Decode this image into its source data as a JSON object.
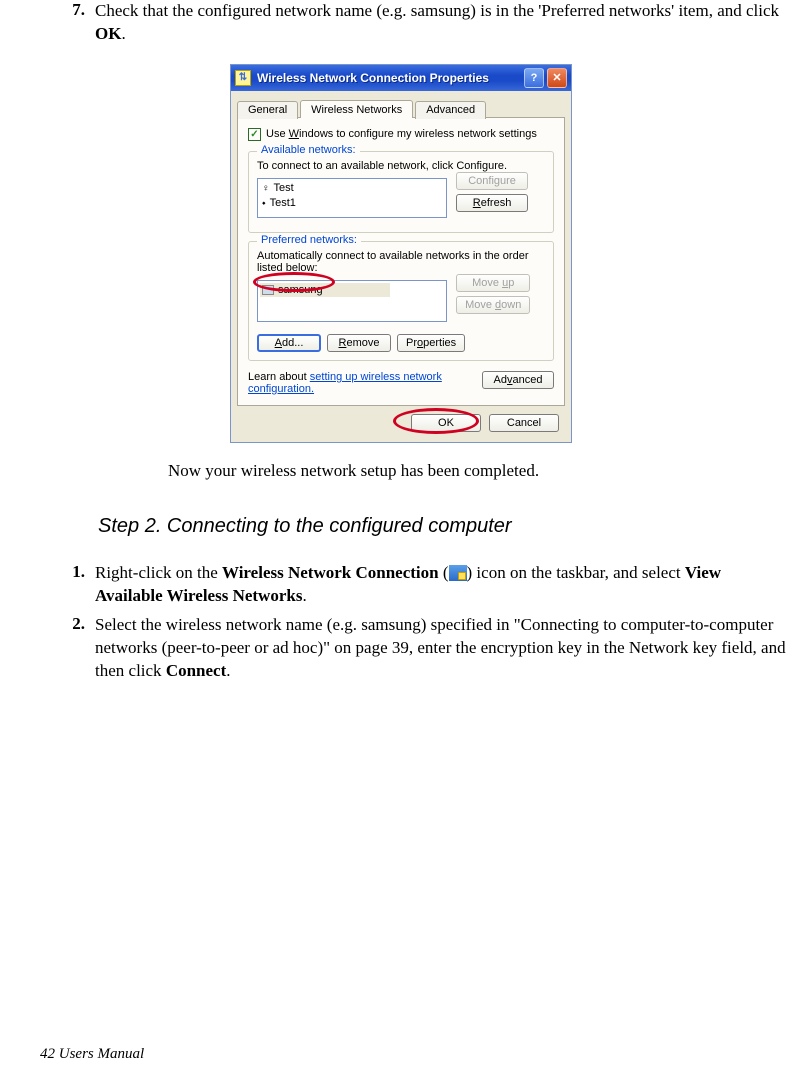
{
  "doc": {
    "step7_num": "7.",
    "step7_text_a": "Check that the configured network name (e.g. samsung) is in the 'Preferred networks' item, and click ",
    "step7_bold": "OK",
    "step7_text_b": ".",
    "post_note": "Now your wireless network setup has been completed.",
    "step2_heading": "Step 2. Connecting to the configured computer",
    "s1_num": "1.",
    "s1_a": "Right-click on the ",
    "s1_b": "Wireless Network Connection",
    "s1_c": " (",
    "s1_d": ") icon on the taskbar, and select ",
    "s1_e": "View Available Wireless Networks",
    "s1_f": ".",
    "s2_num": "2.",
    "s2_a": "Select the wireless network name (e.g. samsung) specified in \"Connecting to computer-to-computer networks (peer-to-peer or ad hoc)\" on page 39, enter the encryption key in the Network key field, and then click ",
    "s2_b": "Connect",
    "s2_c": ".",
    "footer": "42  Users Manual"
  },
  "dialog": {
    "title": "Wireless Network Connection Properties",
    "tabs": {
      "general": "General",
      "wireless": "Wireless Networks",
      "advanced": "Advanced"
    },
    "use_windows_a": "Use ",
    "use_windows_u": "W",
    "use_windows_b": "indows to configure my wireless network settings",
    "available": {
      "legend": "Available networks:",
      "hint": "To connect to an available network, click Configure.",
      "items": [
        "Test",
        "Test1"
      ],
      "configure": "Configure",
      "refresh": "Refresh"
    },
    "preferred": {
      "legend": "Preferred networks:",
      "hint": "Automatically connect to available networks in the order listed below:",
      "item": "samsung",
      "moveup": "Move up",
      "movedown": "Move down",
      "add": "Add...",
      "remove": "Remove",
      "properties": "Properties"
    },
    "learn_a": "Learn about ",
    "learn_link": "setting up wireless network configuration.",
    "advanced_btn": "Advanced",
    "ok": "OK",
    "cancel": "Cancel"
  }
}
